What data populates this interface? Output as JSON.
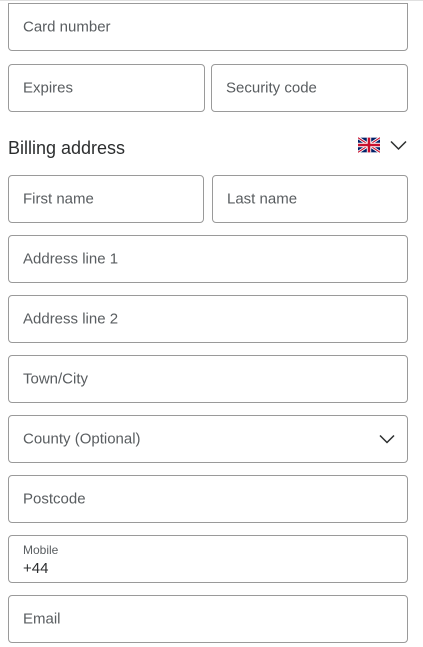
{
  "card": {
    "number_placeholder": "Card number",
    "expires_placeholder": "Expires",
    "security_code_placeholder": "Security code"
  },
  "billing": {
    "title": "Billing address",
    "country_flag_icon": "uk-flag-icon",
    "country_chevron_icon": "chevron-down-icon",
    "first_name_placeholder": "First name",
    "last_name_placeholder": "Last name",
    "address_line1_placeholder": "Address line 1",
    "address_line2_placeholder": "Address line 2",
    "town_placeholder": "Town/City",
    "county_placeholder": "County (Optional)",
    "postcode_placeholder": "Postcode",
    "mobile_label": "Mobile",
    "mobile_prefix": "+44",
    "email_placeholder": "Email"
  },
  "colors": {
    "border": "#9a9a9a",
    "placeholder_text": "#595d60",
    "text": "#2c2e2f"
  }
}
